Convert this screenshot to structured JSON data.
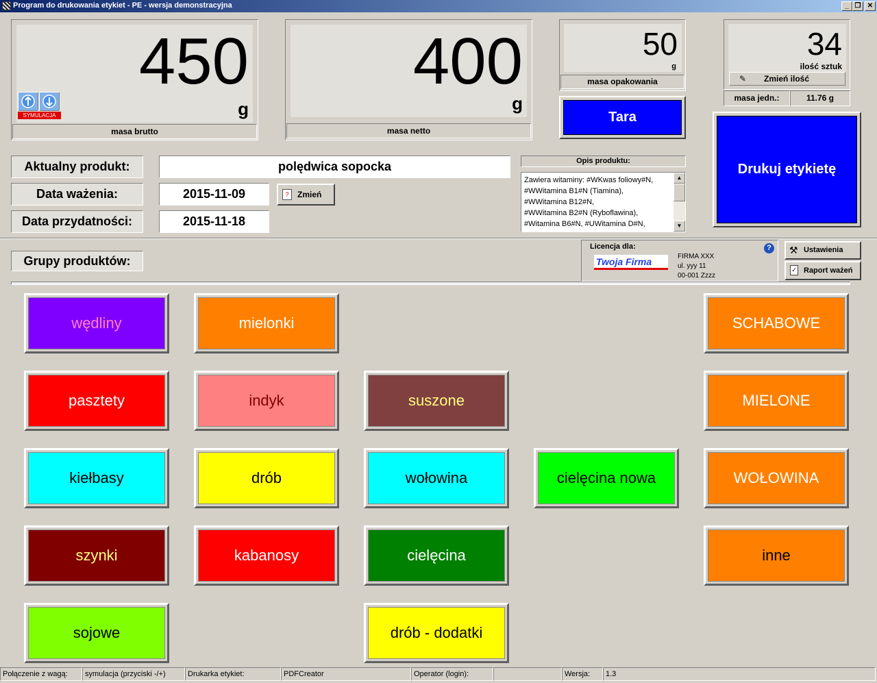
{
  "window": {
    "title": "Program do drukowania etykiet - PE - wersja demonstracyjna"
  },
  "brutto": {
    "value": "450",
    "unit": "g",
    "label": "masa brutto",
    "sim_label": "SYMULACJA"
  },
  "netto": {
    "value": "400",
    "unit": "g",
    "label": "masa netto"
  },
  "opakowanie": {
    "value": "50",
    "unit": "g",
    "label": "masa opakowania"
  },
  "sztuki": {
    "value": "34",
    "unit_label": "ilość sztuk",
    "change_button": "Zmień ilość",
    "unit_mass_label": "masa jedn.:",
    "unit_mass_value": "11.76 g"
  },
  "tara_button": "Tara",
  "print_button": "Drukuj etykietę",
  "product": {
    "current_label": "Aktualny produkt:",
    "current_value": "polędwica sopocka",
    "weigh_label": "Data ważenia:",
    "weigh_value": "2015-11-09",
    "change_button": "Zmień",
    "expiry_label": "Data przydatności:",
    "expiry_value": "2015-11-18"
  },
  "description": {
    "title": "Opis produktu:",
    "lines": [
      "Zawiera witaminy: #WKwas foliowy#N,",
      "#WWitamina B1#N (Tiamina),",
      "#WWitamina B12#N,",
      "#WWitamina B2#N (Ryboflawina),",
      "#Witamina B6#N, #UWitamina D#N,"
    ]
  },
  "license": {
    "title": "Licencja dla:",
    "logo_text": "Twoja Firma",
    "lines": [
      "FIRMA XXX",
      "ul. yyy 11",
      "00-001 Zzzz"
    ]
  },
  "settings_button": "Ustawienia",
  "report_button": "Raport ważeń",
  "groups_label": "Grupy produktów:",
  "groups": [
    {
      "label": "wędliny",
      "bg": "#8000ff",
      "fg": "#ff80c0"
    },
    {
      "label": "mielonki",
      "bg": "#ff8000",
      "fg": "#ffffff"
    },
    {
      "label": "SCHABOWE",
      "bg": "#ff8000",
      "fg": "#ffffff"
    },
    {
      "label": "pasztety",
      "bg": "#ff0000",
      "fg": "#ffffff"
    },
    {
      "label": "indyk",
      "bg": "#ff8080",
      "fg": "#800000"
    },
    {
      "label": "suszone",
      "bg": "#804040",
      "fg": "#ffff80"
    },
    {
      "label": "MIELONE",
      "bg": "#ff8000",
      "fg": "#ffffff"
    },
    {
      "label": "kiełbasy",
      "bg": "#00ffff",
      "fg": "#000000"
    },
    {
      "label": "drób",
      "bg": "#ffff00",
      "fg": "#000000"
    },
    {
      "label": "wołowina",
      "bg": "#00ffff",
      "fg": "#000000"
    },
    {
      "label": "cielęcina nowa",
      "bg": "#00ff00",
      "fg": "#000000"
    },
    {
      "label": "WOŁOWINA",
      "bg": "#ff8000",
      "fg": "#ffffff"
    },
    {
      "label": "szynki",
      "bg": "#800000",
      "fg": "#ffff80"
    },
    {
      "label": "kabanosy",
      "bg": "#ff0000",
      "fg": "#ffffff"
    },
    {
      "label": "cielęcina",
      "bg": "#008000",
      "fg": "#ffffff"
    },
    {
      "label": "inne",
      "bg": "#ff8000",
      "fg": "#000000"
    },
    {
      "label": "sojowe",
      "bg": "#80ff00",
      "fg": "#000000"
    },
    {
      "label": "drób - dodatki",
      "bg": "#ffff00",
      "fg": "#000000"
    }
  ],
  "status": {
    "conn_label": "Połączenie z wagą:",
    "conn_value": "symulacja (przyciski -/+)",
    "printer_label": "Drukarka etykiet:",
    "printer_value": "PDFCreator",
    "operator_label": "Operator (login):",
    "operator_value": "",
    "version_label": "Wersja:",
    "version_value": "1.3"
  },
  "colors": {
    "tara": "#0000ff",
    "print": "#0000ff",
    "title_bar": "#0a246a"
  }
}
